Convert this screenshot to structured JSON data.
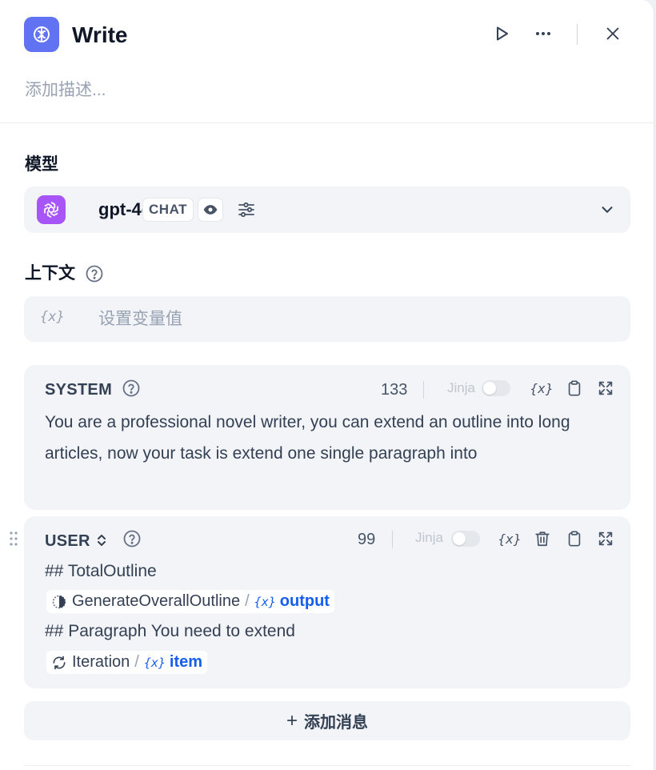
{
  "header": {
    "title": "Write",
    "description_placeholder": "添加描述..."
  },
  "model_section": {
    "label": "模型",
    "model_name": "gpt-4o",
    "mode_badge": "CHAT"
  },
  "context_section": {
    "label": "上下文",
    "var_icon": "{x}",
    "placeholder": "设置变量值"
  },
  "system_message": {
    "role": "SYSTEM",
    "char_count": "133",
    "jinja_label": "Jinja",
    "jinja_enabled": false,
    "var_icon": "{x}",
    "text": "You are a professional novel writer, you can extend an outline into long articles, now your task is extend one single paragraph into"
  },
  "user_message": {
    "role": "USER",
    "char_count": "99",
    "jinja_label": "Jinja",
    "jinja_enabled": false,
    "var_icon": "{x}",
    "line1": "## TotalOutline",
    "ref1": {
      "node": "GenerateOverallOutline",
      "separator": "/",
      "var_icon": "{x}",
      "var": "output"
    },
    "line2": "## Paragraph You need to extend",
    "ref2": {
      "node": "Iteration",
      "separator": "/",
      "var_icon": "{x}",
      "var": "item"
    }
  },
  "add_message": {
    "plus": "+",
    "label": "添加消息"
  },
  "icons": {
    "node": "brain-icon",
    "run": "play-icon",
    "more": "more-icon",
    "close": "close-icon",
    "model_logo": "openai-logo-icon",
    "vision": "eye-icon",
    "params": "sliders-icon",
    "expand": "chevron-down-icon",
    "help": "help-circle-icon",
    "copy": "clipboard-icon",
    "fullscreen": "expand-icon",
    "delete": "trash-icon",
    "role_switch": "chevron-updown-icon",
    "drag": "drag-handle-icon"
  },
  "colors": {
    "accent": "#6172f3",
    "model_logo_bg": "#a855f7",
    "variable_blue": "#155eef",
    "surface": "#f2f4f7"
  }
}
